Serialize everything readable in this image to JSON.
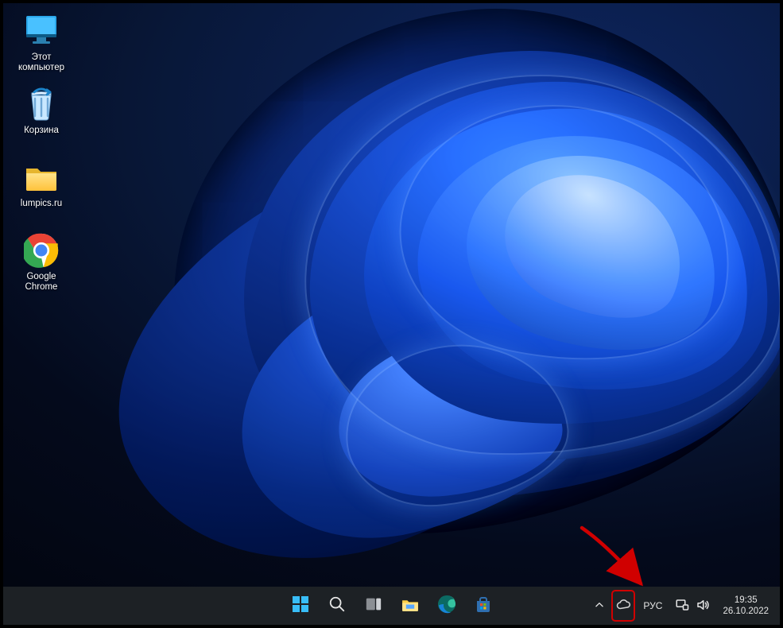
{
  "desktop_icons": [
    {
      "id": "this-pc",
      "label": "Этот компьютер"
    },
    {
      "id": "recycle",
      "label": "Корзина"
    },
    {
      "id": "folder",
      "label": "lumpics.ru"
    },
    {
      "id": "chrome",
      "label": "Google Chrome"
    }
  ],
  "taskbar": {
    "start": "start-icon",
    "search": "search-icon",
    "taskview": "taskview-icon",
    "explorer": "file-explorer-icon",
    "edge": "edge-icon",
    "store": "microsoft-store-icon"
  },
  "tray": {
    "overflow": "chevron-up-icon",
    "onedrive": "cloud-icon",
    "language": "РУС",
    "network": "network-icon",
    "volume": "volume-icon",
    "time": "19:35",
    "date": "26.10.2022"
  },
  "annotation": {
    "highlight_target": "onedrive-tray-icon"
  }
}
